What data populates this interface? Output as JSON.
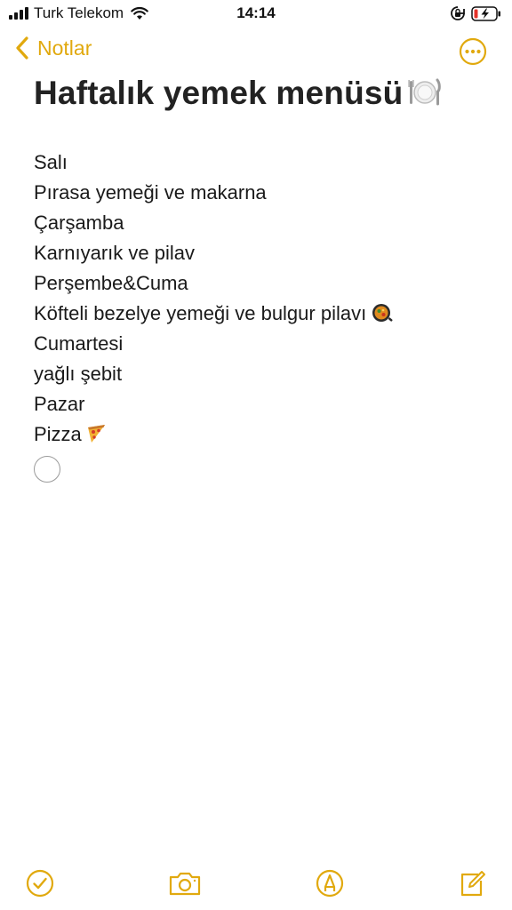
{
  "status_bar": {
    "carrier": "Turk Telekom",
    "time": "14:14",
    "icons": [
      "signal-icon",
      "wifi-icon",
      "orientation-lock-icon",
      "battery-charging-icon"
    ]
  },
  "nav": {
    "back_label": "Notlar",
    "more_icon": "ellipsis-circle-icon"
  },
  "note": {
    "title": "Haftalık yemek menüsü",
    "title_emoji": "plate-fork-knife",
    "lines": [
      "Salı",
      "Pırasa yemeği ve makarna",
      "Çarşamba",
      "Karnıyarık ve pilav",
      "Perşembe&Cuma",
      "Köfteli bezelye yemeği ve bulgur pilavı",
      "Cumartesi",
      "yağlı şebit",
      "Pazar",
      "Pizza"
    ],
    "line_emojis": {
      "5": "shallow-pan-of-food",
      "9": "pizza-slice"
    },
    "checklist_item": {
      "checked": false,
      "text": ""
    }
  },
  "toolbar": {
    "icons": [
      "checklist-icon",
      "camera-icon",
      "markup-pen-icon",
      "compose-icon"
    ]
  },
  "colors": {
    "accent": "#E1A90E",
    "text": "#1a1a1a",
    "background": "#FFFFFF",
    "battery_low": "#E5332A"
  }
}
